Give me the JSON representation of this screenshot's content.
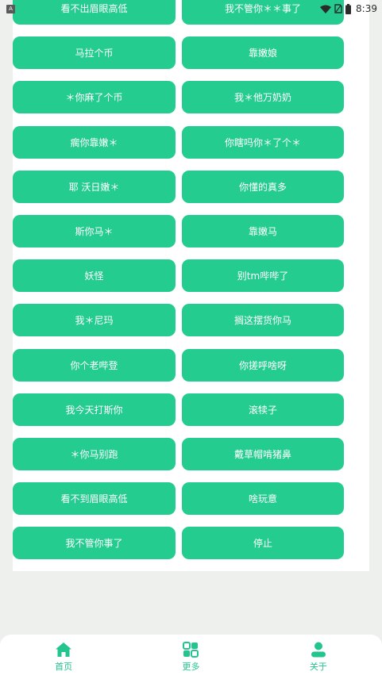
{
  "status_bar": {
    "notification_letter": "A",
    "time": "8:39",
    "icons": [
      "wifi-icon",
      "no-sim-icon",
      "battery-icon"
    ]
  },
  "buttons": [
    {
      "label": "看不出眉眼高低"
    },
    {
      "label": "我不管你＊＊事了"
    },
    {
      "label": "马拉个币"
    },
    {
      "label": "靠嫩娘"
    },
    {
      "label": "＊你麻了个币"
    },
    {
      "label": "我＊他万奶奶"
    },
    {
      "label": "瘸你靠嫩＊"
    },
    {
      "label": "你瞎吗你＊了个＊"
    },
    {
      "label": "耶 沃日嫩＊"
    },
    {
      "label": "你懂的真多"
    },
    {
      "label": "斯你马＊"
    },
    {
      "label": "靠嫩马"
    },
    {
      "label": "妖怪"
    },
    {
      "label": "别tm哔哔了"
    },
    {
      "label": "我＊尼玛"
    },
    {
      "label": "搁这摆货你马"
    },
    {
      "label": "你个老哔登"
    },
    {
      "label": "你搓呼啥呀"
    },
    {
      "label": "我今天打斯你"
    },
    {
      "label": "滚犊子"
    },
    {
      "label": "＊你马别跑"
    },
    {
      "label": "戴草帽啃猪鼻"
    },
    {
      "label": "看不到眉眼高低"
    },
    {
      "label": "啥玩意"
    },
    {
      "label": "我不管你事了"
    },
    {
      "label": "停止"
    }
  ],
  "bottom_nav": [
    {
      "label": "首页",
      "icon": "home-icon"
    },
    {
      "label": "更多",
      "icon": "more-icon"
    },
    {
      "label": "关于",
      "icon": "user-icon"
    }
  ],
  "colors": {
    "accent": "#24cc8f",
    "background": "#eef0ee",
    "card": "#ffffff",
    "nav_label": "#24c58c"
  }
}
